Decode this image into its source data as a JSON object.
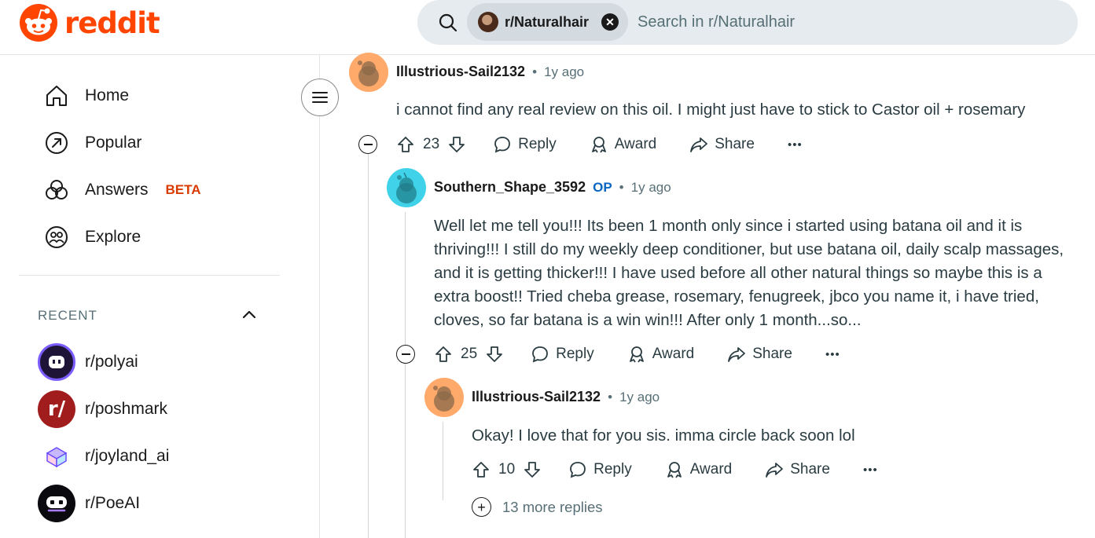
{
  "brand": {
    "name": "reddit",
    "accent": "#ff4500"
  },
  "search": {
    "community": "r/Naturalhair",
    "placeholder": "Search in r/Naturalhair"
  },
  "sidebar": {
    "nav": [
      {
        "label": "Home",
        "icon": "home-icon"
      },
      {
        "label": "Popular",
        "icon": "popular-icon"
      },
      {
        "label": "Answers",
        "icon": "answers-icon",
        "badge": "BETA"
      },
      {
        "label": "Explore",
        "icon": "explore-icon"
      }
    ],
    "recent_label": "RECENT",
    "recent": [
      {
        "label": "r/polyai",
        "icon": "polyai-icon"
      },
      {
        "label": "r/poshmark",
        "icon": "poshmark-icon"
      },
      {
        "label": "r/joyland_ai",
        "icon": "joyland-icon"
      },
      {
        "label": "r/PoeAI",
        "icon": "poeai-icon"
      }
    ]
  },
  "comments": [
    {
      "author": "Illustrious-Sail2132",
      "time": "1y ago",
      "body": "i cannot find any real review on this oil. I might just have to stick to Castor oil + rosemary",
      "votes": "23"
    },
    {
      "author": "Southern_Shape_3592",
      "op": "OP",
      "time": "1y ago",
      "body": "Well let me tell you!!! Its been 1 month only since i started using batana oil and it is thriving!!! I still do my weekly deep conditioner, but use batana oil, daily scalp massages, and it is getting thicker!!! I have used before all other natural things so maybe this is a extra boost!! Tried cheba grease, rosemary, fenugreek, jbco you name it, i have tried, cloves, so far batana is a win win!!! After only 1 month...so...",
      "votes": "25"
    },
    {
      "author": "Illustrious-Sail2132",
      "time": "1y ago",
      "body": "Okay! I love that for you sis. imma circle back soon lol",
      "votes": "10"
    }
  ],
  "actions": {
    "reply": "Reply",
    "award": "Award",
    "share": "Share",
    "overflow": "•••"
  },
  "more_replies": "13 more replies",
  "separator": "•"
}
